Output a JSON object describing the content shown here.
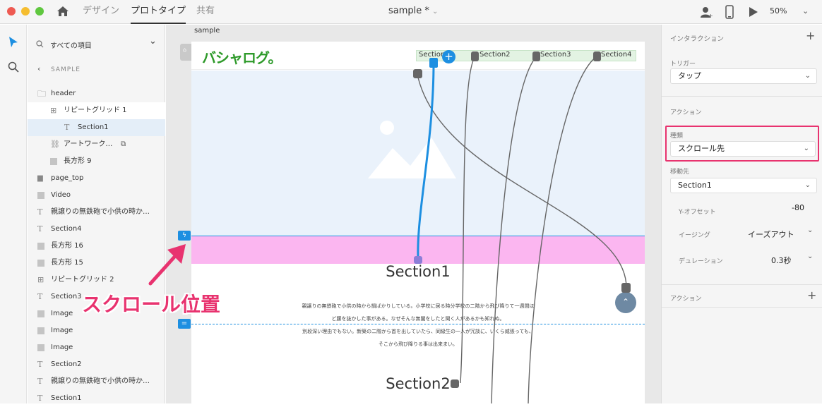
{
  "titlebar": {
    "tabs": [
      "デザイン",
      "プロトタイプ",
      "共有"
    ],
    "doc_title": "sample *",
    "zoom": "50%"
  },
  "layers": {
    "search_placeholder": "すべての項目",
    "back_label": "SAMPLE",
    "items": [
      {
        "label": "header",
        "kind": "folder"
      },
      {
        "label": "リピートグリッド 1",
        "kind": "grid"
      },
      {
        "label": "Section1",
        "kind": "text"
      },
      {
        "label": "アートワーク…",
        "kind": "link"
      },
      {
        "label": "長方形 9",
        "kind": "rect"
      },
      {
        "label": "page_top",
        "kind": "folder-filled"
      },
      {
        "label": "Video",
        "kind": "rect"
      },
      {
        "label": "親譲りの無鉄砲で小供の時か…",
        "kind": "text"
      },
      {
        "label": "Section4",
        "kind": "text"
      },
      {
        "label": "長方形 16",
        "kind": "rect"
      },
      {
        "label": "長方形 15",
        "kind": "rect"
      },
      {
        "label": "リピートグリッド 2",
        "kind": "grid"
      },
      {
        "label": "Section3",
        "kind": "text"
      },
      {
        "label": "Image",
        "kind": "rect"
      },
      {
        "label": "Image",
        "kind": "rect"
      },
      {
        "label": "Image",
        "kind": "rect"
      },
      {
        "label": "Section2",
        "kind": "text"
      },
      {
        "label": "親譲りの無鉄砲で小供の時か…",
        "kind": "text"
      },
      {
        "label": "Section1",
        "kind": "text"
      }
    ]
  },
  "canvas": {
    "artboard_name": "sample",
    "logo": "バシャログ。",
    "nav": [
      "Section1",
      "Section2",
      "Section3",
      "Section4"
    ],
    "section1_title": "Section1",
    "section2_title": "Section2",
    "body_lines": [
      "親譲りの無鉄砲で小供の時から損ばかりしている。小学校に居る時分学校の二階から飛び降りて一週間ほ",
      "ど腰を抜かした事がある。なぜそんな無闇をしたと聞く人があるかも知れぬ。",
      "別段深い理由でもない。新築の二階から首を出していたら、同級生の一人が冗談に、いくら威張っても、",
      "そこから飛び降りる事は出来まい。"
    ],
    "annotation": "スクロール位置"
  },
  "panel": {
    "interaction_header": "インタラクション",
    "trigger_label": "トリガー",
    "trigger_value": "タップ",
    "action_header": "アクション",
    "type_label": "種類",
    "type_value": "スクロール先",
    "dest_label": "移動先",
    "dest_value": "Section1",
    "yoffset_label": "Y-オフセット",
    "yoffset_value": "-80",
    "easing_label": "イージング",
    "easing_value": "イーズアウト",
    "duration_label": "デュレーション",
    "duration_value": "0.3秒",
    "action2_header": "アクション"
  },
  "colors": {
    "accent_blue": "#1d8fe1",
    "highlight_pink": "#e8336f",
    "scroll_band": "#fbb6f0",
    "logo_green": "#2e9a2a"
  }
}
